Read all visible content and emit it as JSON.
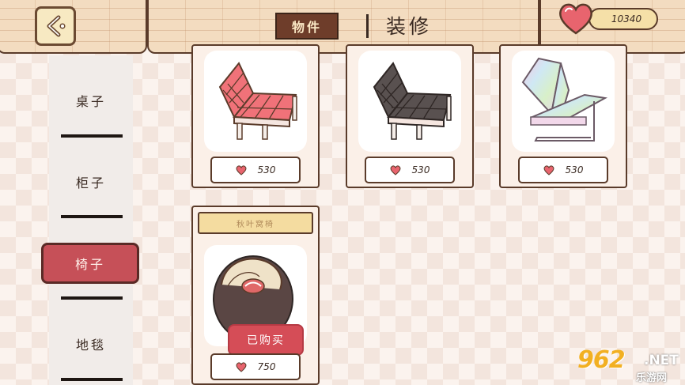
{
  "header": {
    "tab_items_label": "物件",
    "tab_decor_label": "装修",
    "currency_value": "10340"
  },
  "sidebar": {
    "items": [
      {
        "label": "桌子"
      },
      {
        "label": "柜子"
      },
      {
        "label": "椅子"
      },
      {
        "label": "地毯"
      }
    ]
  },
  "products": [
    {
      "price": "530",
      "color": "#f07279"
    },
    {
      "price": "530",
      "color": "#595150"
    },
    {
      "price": "530",
      "color": "#d6e8d0"
    },
    {
      "name": "秋叶窝椅",
      "price": "750",
      "status": "已购买",
      "color": "#d0555d"
    }
  ],
  "watermark": {
    "logo": "962",
    "suffix": ".NET",
    "sub": "乐游网"
  },
  "colors": {
    "accent_red": "#c65058",
    "wood": "#f3dcc0",
    "outline": "#5a3b2a"
  }
}
